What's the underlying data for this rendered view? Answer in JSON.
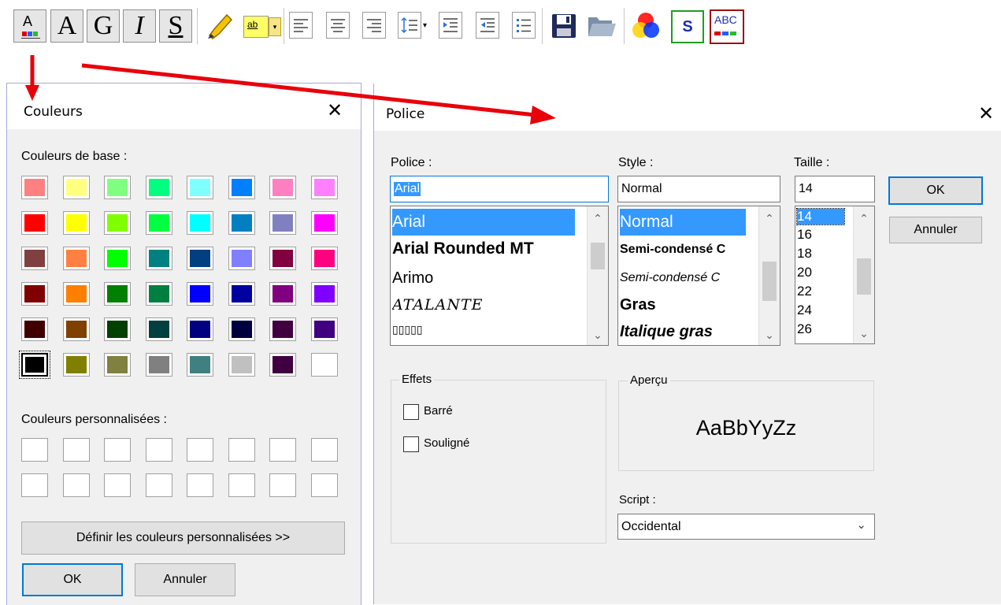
{
  "toolbar": {
    "a_label": "A",
    "bold_label": "A",
    "g_label": "G",
    "italic_label": "I",
    "underline_label": "S",
    "spell_s": "S",
    "abc_label": "ABC",
    "ab_label": "ab"
  },
  "colors_dialog": {
    "title": "Couleurs",
    "base_label": "Couleurs de base :",
    "custom_label": "Couleurs personnalisées :",
    "define_button": "Définir les couleurs personnalisées >>",
    "ok_button": "OK",
    "cancel_button": "Annuler",
    "base_colors": [
      [
        "#ff8080",
        "#ffff80",
        "#80ff80",
        "#00ff80",
        "#80ffff",
        "#0080ff",
        "#ff80c0",
        "#ff80ff"
      ],
      [
        "#ff0000",
        "#ffff00",
        "#80ff00",
        "#00ff40",
        "#00ffff",
        "#0080c0",
        "#8080c0",
        "#ff00ff"
      ],
      [
        "#804040",
        "#ff8040",
        "#00ff00",
        "#008080",
        "#004080",
        "#8080ff",
        "#800040",
        "#ff0080"
      ],
      [
        "#800000",
        "#ff8000",
        "#008000",
        "#008040",
        "#0000ff",
        "#0000a0",
        "#800080",
        "#8000ff"
      ],
      [
        "#400000",
        "#804000",
        "#004000",
        "#004040",
        "#000080",
        "#000040",
        "#400040",
        "#400080"
      ],
      [
        "#000000",
        "#808000",
        "#808040",
        "#808080",
        "#408080",
        "#c0c0c0",
        "#400040",
        "#ffffff"
      ]
    ]
  },
  "font_dialog": {
    "title": "Police",
    "font_label": "Police :",
    "style_label": "Style :",
    "size_label": "Taille :",
    "font_value": "Arial",
    "style_value": "Normal",
    "size_value": "14",
    "fonts": [
      "Arial",
      "Arial Rounded MT",
      "Arimo",
      "ATALANTE",
      "▯▯▯▯▯"
    ],
    "styles": [
      "Normal",
      "Semi-condensé C",
      "Semi-condensé C",
      "Gras",
      "Italique gras"
    ],
    "sizes": [
      "14",
      "16",
      "18",
      "20",
      "22",
      "24",
      "26"
    ],
    "ok_button": "OK",
    "cancel_button": "Annuler",
    "effects_label": "Effets",
    "strike_label": "Barré",
    "underline_label": "Souligné",
    "preview_label": "Aperçu",
    "preview_text": "AaBbYyZz",
    "script_label": "Script :",
    "script_value": "Occidental"
  }
}
